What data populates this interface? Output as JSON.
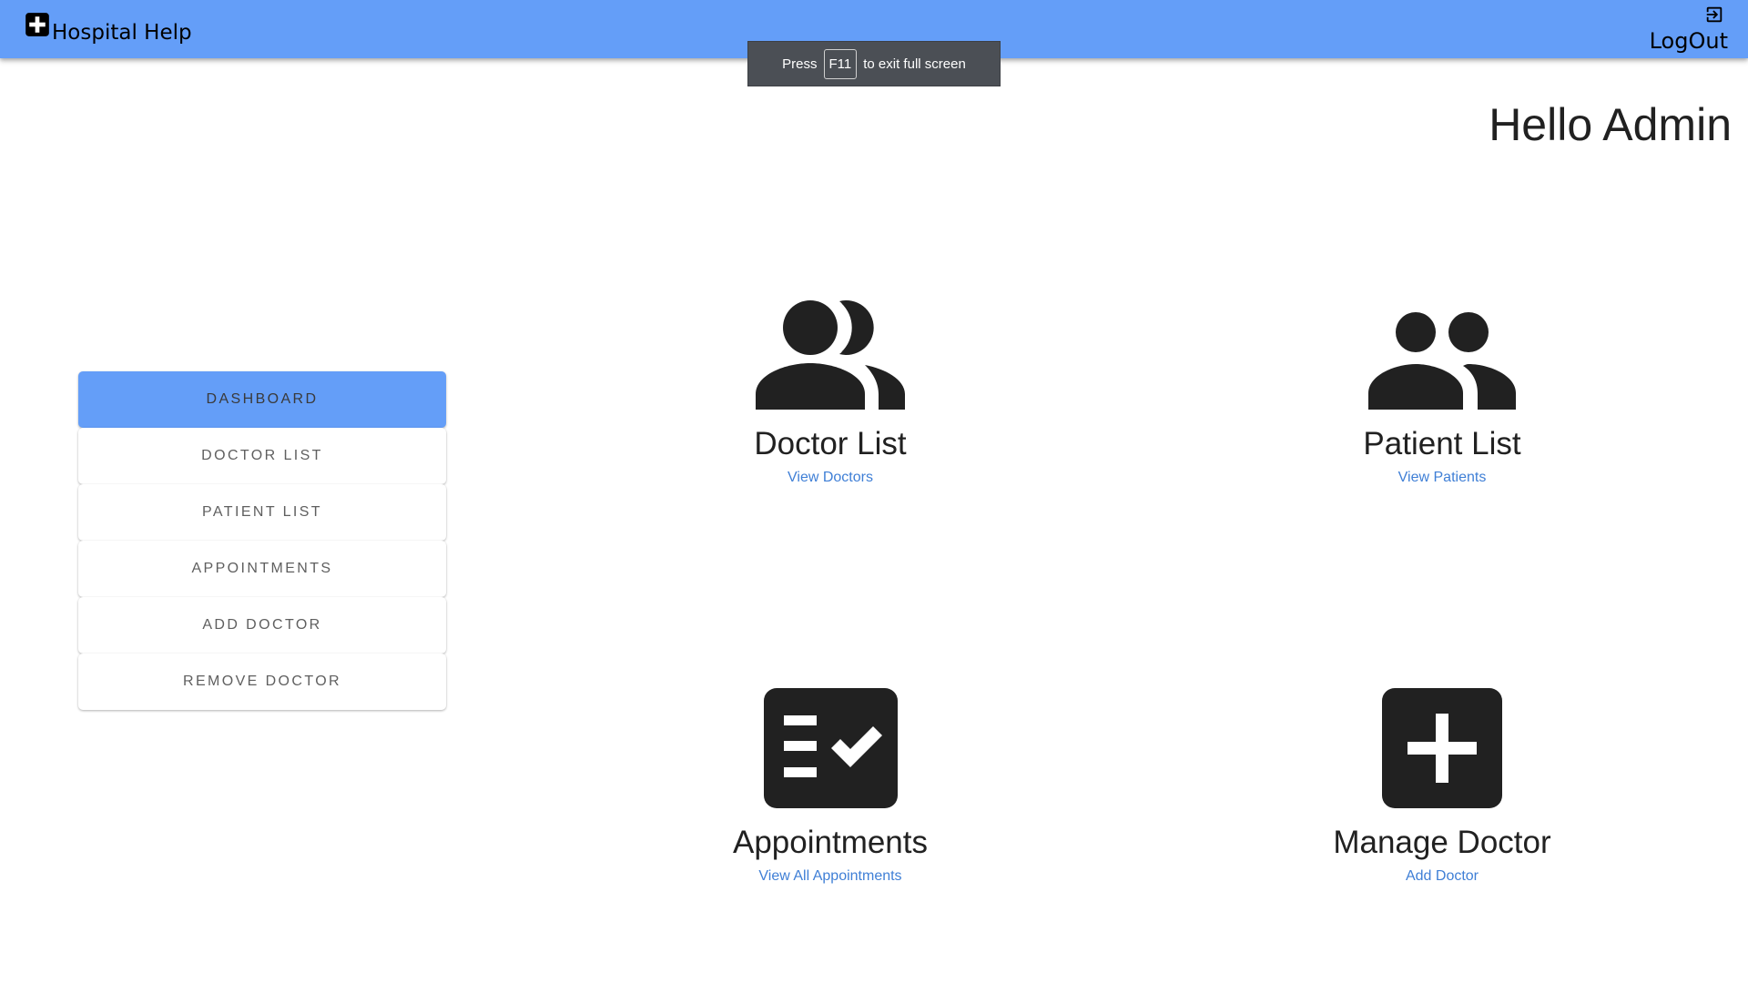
{
  "app": {
    "title": "Hospital Help",
    "logout_label": "LogOut"
  },
  "fullscreen_notice": {
    "before": "Press",
    "key": "F11",
    "after": "to exit full screen"
  },
  "greeting": "Hello Admin",
  "sidebar": {
    "items": [
      {
        "label": "DASHBOARD",
        "active": true
      },
      {
        "label": "DOCTOR LIST",
        "active": false
      },
      {
        "label": "PATIENT LIST",
        "active": false
      },
      {
        "label": "APPOINTMENTS",
        "active": false
      },
      {
        "label": "ADD DOCTOR",
        "active": false
      },
      {
        "label": "REMOVE DOCTOR",
        "active": false
      }
    ]
  },
  "cards": [
    {
      "title": "Doctor List",
      "link": "View Doctors",
      "icon": "supervisor-group-icon"
    },
    {
      "title": "Patient List",
      "link": "View Patients",
      "icon": "people-group-icon"
    },
    {
      "title": "Appointments",
      "link": "View All Appointments",
      "icon": "checklist-icon"
    },
    {
      "title": "Manage Doctor",
      "link": "Add Doctor",
      "icon": "add-box-icon"
    }
  ],
  "colors": {
    "topbar": "#649ef8",
    "active_button": "#649ef8",
    "link": "#3f7fd6",
    "icon": "#212121"
  }
}
